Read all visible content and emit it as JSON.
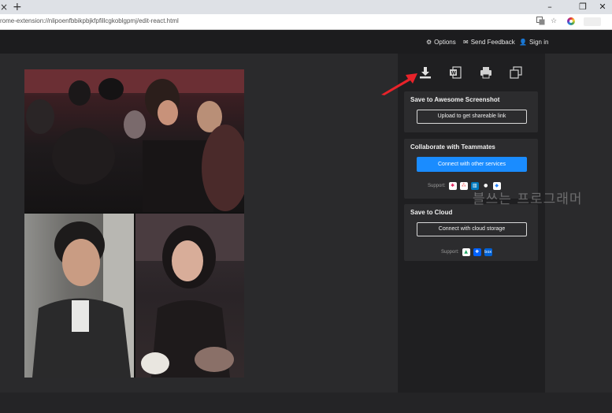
{
  "browser": {
    "tab_close_glyph": "×",
    "new_tab_glyph": "+",
    "minimize_glyph": "–",
    "maximize_glyph": "❐",
    "close_glyph": "✕",
    "url": "rome-extension://nlipoenfbbikpbjkfpfillcgkoblgpmj/edit-react.html",
    "translate_icon": "translate-icon",
    "star_icon": "star-icon"
  },
  "header": {
    "options_label": "Options",
    "feedback_label": "Send Feedback",
    "signin_label": "Sign in"
  },
  "toolbar": {
    "icons": [
      "download-icon",
      "word-export-icon",
      "print-icon",
      "copy-icon"
    ]
  },
  "sections": {
    "awesome": {
      "title": "Save to Awesome Screenshot",
      "button": "Upload to get shareable link"
    },
    "collaborate": {
      "title": "Collaborate with Teammates",
      "button": "Connect with other services",
      "support_label": "Support:",
      "services": [
        "slack-icon",
        "asana-icon",
        "trello-icon",
        "github-icon",
        "jira-icon"
      ]
    },
    "cloud": {
      "title": "Save to Cloud",
      "button": "Connect with cloud storage",
      "support_label": "Support:",
      "services": [
        "google-drive-icon",
        "dropbox-icon",
        "box-icon"
      ]
    }
  },
  "watermark": "블쓰는 프로그래머",
  "colors": {
    "accent": "#1a8cff",
    "arrow": "#e8232a"
  }
}
